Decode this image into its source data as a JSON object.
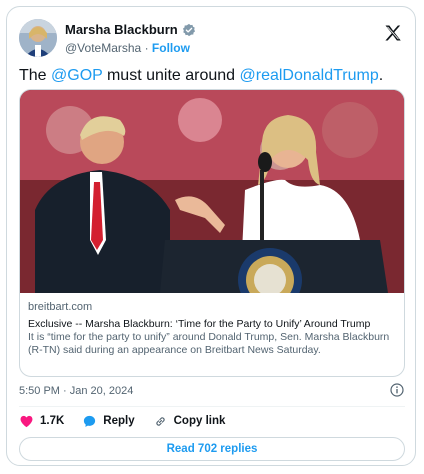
{
  "author": {
    "name": "Marsha Blackburn",
    "handle": "@VoteMarsha",
    "separator": "·",
    "follow_label": "Follow"
  },
  "tweet": {
    "text_before": "The ",
    "mention_1": "@GOP",
    "text_middle": " must unite around ",
    "mention_2": "@realDonaldTrump",
    "text_after": "."
  },
  "link_card": {
    "domain": "breitbart.com",
    "title": "Exclusive -- Marsha Blackburn: ‘Time for the Party to Unify’ Around Trump",
    "description": "It is “time for the party to unify” around Donald Trump, Sen. Marsha Blackburn (R-TN) said during an appearance on Breitbart News Saturday."
  },
  "timestamp": "5:50 PM · Jan 20, 2024",
  "actions": {
    "likes_count": "1.7K",
    "reply_label": "Reply",
    "copy_link_label": "Copy link"
  },
  "read_replies_label": "Read 702 replies",
  "colors": {
    "accent": "#1d9bf0",
    "like": "#f91880",
    "text": "#0f1419",
    "muted": "#536471",
    "border": "#cfd9de"
  },
  "icons": [
    "verified-badge-icon",
    "x-logo-icon",
    "info-icon",
    "heart-icon",
    "reply-bubble-icon",
    "link-icon"
  ]
}
